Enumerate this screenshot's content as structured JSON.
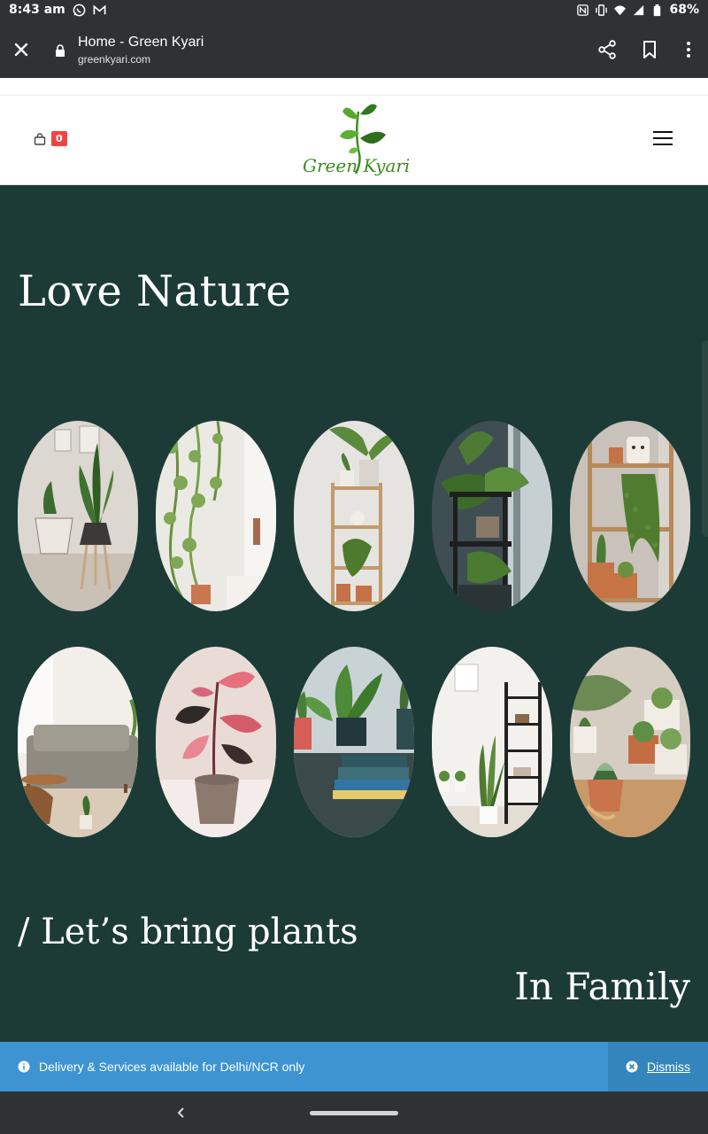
{
  "status_bar": {
    "time": "8:43 am",
    "battery": "68%",
    "left_icons": [
      "whatsapp-icon",
      "gmail-icon"
    ],
    "right_icons": [
      "nfc-icon",
      "vibrate-icon",
      "wifi-icon",
      "signal-icon",
      "battery-icon"
    ]
  },
  "browser": {
    "title": "Home - Green Kyari",
    "url": "greenkyari.com",
    "icons": [
      "close-icon",
      "lock-icon",
      "share-icon",
      "bookmark-icon",
      "overflow-menu-icon"
    ]
  },
  "header": {
    "cart_count": "0",
    "logo_text": "Green Kyari",
    "brand_color": "#2e8b2e"
  },
  "hero": {
    "title": "Love Nature",
    "tagline": "/ Let’s bring plants",
    "tagline2": "In Family",
    "background": "#1d3b36",
    "photos": [
      "zz-plant-basket",
      "trailing-pothos-wall",
      "wooden-shelf-spider-plant",
      "dark-stand-window",
      "shelf-cactus-string-of-pearls",
      "living-room-sofa",
      "pink-princess-philodendron",
      "plants-with-books",
      "black-shelf-snake-plant",
      "succulent-pots-table"
    ]
  },
  "notice": {
    "text": "Delivery & Services available for Delhi/NCR only",
    "dismiss_label": "Dismiss",
    "color": "#3d94d0"
  }
}
